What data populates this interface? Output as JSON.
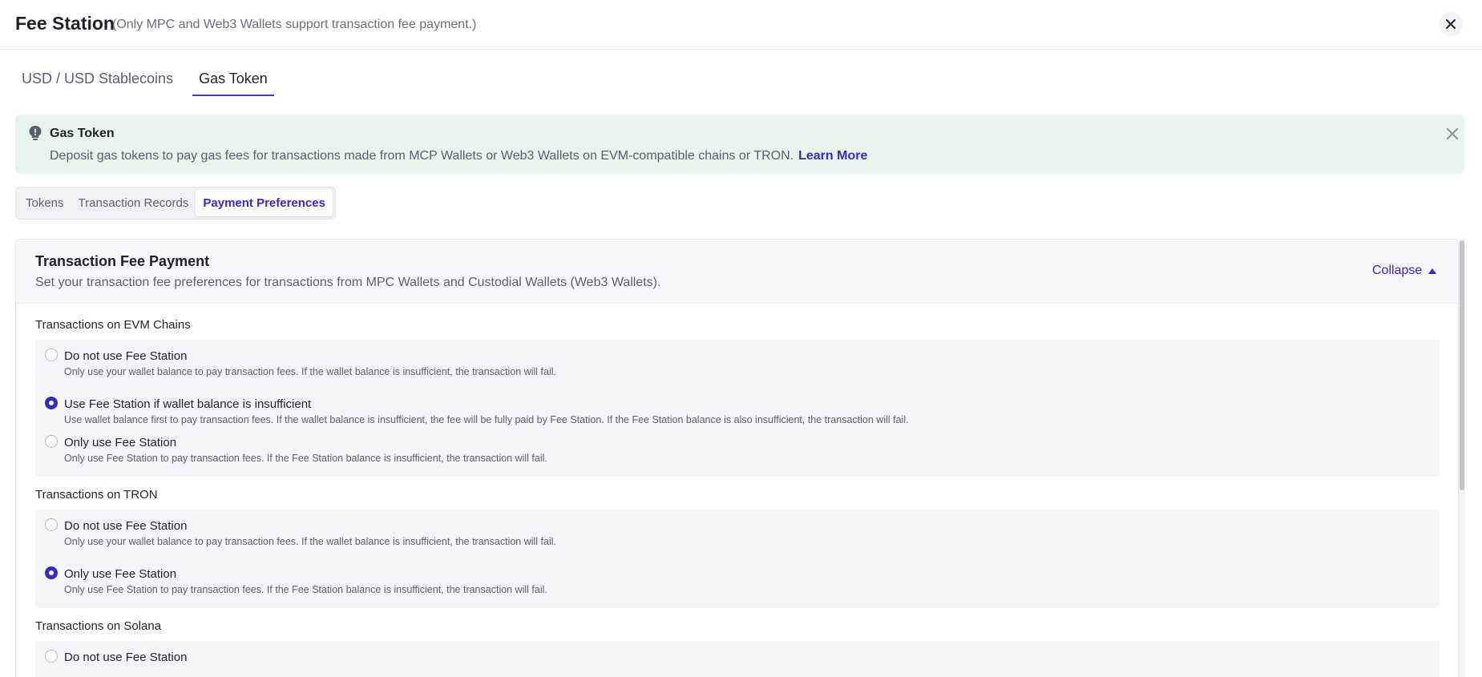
{
  "header": {
    "title": "Fee Station",
    "note": "(Only MPC and Web3 Wallets support transaction fee payment.)",
    "close_icon": "close-icon"
  },
  "top_tabs": [
    {
      "label": "USD / USD Stablecoins",
      "active": false
    },
    {
      "label": "Gas Token",
      "active": true
    }
  ],
  "alert": {
    "icon": "lightbulb-icon",
    "title": "Gas Token",
    "text": "Deposit gas tokens to pay gas fees for transactions made from MCP Wallets or Web3 Wallets on EVM-compatible chains or TRON.",
    "link": "Learn More",
    "background": "#e6f5ee"
  },
  "sub_tabs": [
    {
      "label": "Tokens",
      "active": false
    },
    {
      "label": "Transaction Records",
      "active": false
    },
    {
      "label": "Payment Preferences",
      "active": true
    }
  ],
  "panel": {
    "title": "Transaction Fee Payment",
    "description": "Set your transaction fee preferences for transactions from MPC Wallets and Custodial Wallets (Web3 Wallets).",
    "collapse_label": "Collapse",
    "sections": [
      {
        "label": "Transactions on EVM Chains",
        "options": [
          {
            "label": "Do not use Fee Station",
            "desc": "Only use your wallet balance to pay transaction fees. If the wallet balance is insufficient, the transaction will fail.",
            "checked": false
          },
          {
            "label": "Use Fee Station if wallet balance is insufficient",
            "desc": "Use wallet balance first to pay transaction fees. If the wallet balance is insufficient, the fee will be fully paid by Fee Station. If the Fee Station balance is also insufficient, the transaction will fail.",
            "checked": true
          },
          {
            "label": "Only use Fee Station",
            "desc": "Only use Fee Station to pay transaction fees. If the Fee Station balance is insufficient, the transaction will fail.",
            "checked": false
          }
        ]
      },
      {
        "label": "Transactions on TRON",
        "options": [
          {
            "label": "Do not use Fee Station",
            "desc": "Only use your wallet balance to pay transaction fees. If the wallet balance is insufficient, the transaction will fail.",
            "checked": false
          },
          {
            "label": "Only use Fee Station",
            "desc": "Only use Fee Station to pay transaction fees. If the Fee Station balance is insufficient, the transaction will fail.",
            "checked": true
          }
        ]
      },
      {
        "label": "Transactions on Solana",
        "options": [
          {
            "label": "Do not use Fee Station",
            "desc": "",
            "checked": false
          }
        ]
      }
    ]
  },
  "colors": {
    "accent": "#3a27c9",
    "tab_underline": "#4632d6"
  }
}
